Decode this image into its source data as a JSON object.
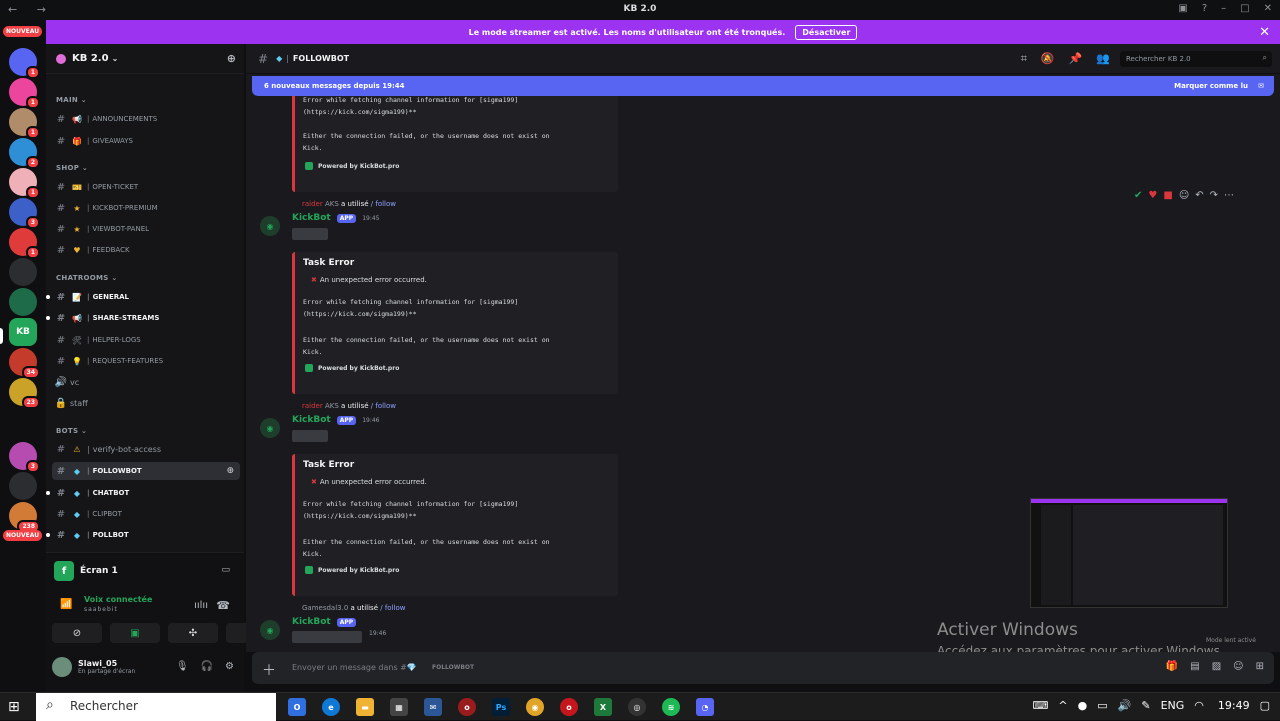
{
  "window": {
    "title": "KB 2.0"
  },
  "banner": {
    "text": "Le mode streamer est activé. Les noms d'utilisateur ont été tronqués.",
    "button": "Désactiver"
  },
  "servers": {
    "nouveau_top": "NOUVEAU",
    "nouveau_bottom": "NOUVEAU",
    "items": [
      {
        "badge": "1",
        "color": "#5865f2"
      },
      {
        "badge": "1",
        "color": "#eb459e"
      },
      {
        "badge": "1",
        "color": "#b18c6a"
      },
      {
        "badge": "2",
        "color": "#2f8fd6"
      },
      {
        "badge": "1",
        "color": "#f0b0b8"
      },
      {
        "badge": "3",
        "color": "#3c5fc8"
      },
      {
        "badge": "1",
        "color": "#e03b3b"
      },
      {
        "badge": "",
        "color": "#2b2d31"
      },
      {
        "badge": "",
        "color": "#1e6b4a"
      },
      {
        "badge": "",
        "color": "#23a55a",
        "label": "KB"
      },
      {
        "badge": "34",
        "color": "#c43b2b"
      },
      {
        "badge": "23",
        "color": "#c9a227"
      },
      {
        "badge": "3",
        "color": "#b64bb0"
      },
      {
        "badge": "",
        "color": "#2b2d31"
      },
      {
        "badge": "238",
        "color": "#d27b37"
      }
    ]
  },
  "server": {
    "name": "KB 2.0"
  },
  "categories": {
    "main": "MAIN",
    "shop": "SHOP",
    "chatrooms": "CHATROOMS",
    "bots": "BOTS"
  },
  "channels": {
    "announcements": "ANNOUNCEMENTS",
    "giveaways": "GIVEAWAYS",
    "open_ticket": "OPEN-TICKET",
    "kickbot_premium": "KICKBOT-PREMIUM",
    "viewbot_panel": "VIEWBOT-PANEL",
    "feedback": "FEEDBACK",
    "general": "GENERAL",
    "share_streams": "SHARE-STREAMS",
    "helper_logs": "HELPER-LOGS",
    "request_features": "REQUEST-FEATURES",
    "vc": "vc",
    "staff": "staff",
    "verify_bot_access": "verify-bot-access",
    "followbot": "FOLLOWBOT",
    "chatbot": "CHATBOT",
    "clipbot": "CLIPBOT",
    "pollbot": "POLLBOT"
  },
  "voice": {
    "screen": "Écran 1",
    "status": "Voix connectée",
    "sub": "saabebit"
  },
  "user": {
    "name": "Slawi_05",
    "status": "En partage d'écran"
  },
  "chat_header": {
    "channel": "FOLLOWBOT",
    "search_placeholder": "Rechercher KB 2.0"
  },
  "new_messages": {
    "text": "6 nouveaux messages depuis 19:44",
    "mark": "Marquer comme lu"
  },
  "embed": {
    "title": "Task Error",
    "error": "An unexpected error occurred.",
    "code1": "Error while fetching channel information for [sigma199]",
    "code2": "(https://kick.com/sigma199)**",
    "code3": "Either the connection failed, or the username does not exist on",
    "code4": "Kick.",
    "footer": "Powered by KickBot.pro"
  },
  "messages": [
    {
      "reply_user": "raider",
      "reply_tag": "AKS",
      "reply_text": "a utilisé",
      "command": "/ follow",
      "author": "KickBot",
      "app": "APP",
      "time": "19:45"
    },
    {
      "reply_user": "raider",
      "reply_tag": "AKS",
      "reply_text": "a utilisé",
      "command": "/ follow",
      "author": "KickBot",
      "app": "APP",
      "time": "19:46"
    },
    {
      "reply_user": "Gamesdal3.0",
      "reply_tag": "",
      "reply_text": "a utilisé",
      "command": "/ follow",
      "author": "KickBot",
      "app": "APP",
      "time": "19:46"
    }
  ],
  "composer": {
    "placeholder": "Envoyer un message dans #💎",
    "channel": "FOLLOWBOT"
  },
  "watermark": {
    "line1": "Activer Windows",
    "line2": "Accédez aux paramètres pour activer Windows.",
    "mode": "Mode lent activé"
  },
  "taskbar": {
    "search": "Rechercher",
    "lang": "ENG",
    "time": "19:49"
  }
}
